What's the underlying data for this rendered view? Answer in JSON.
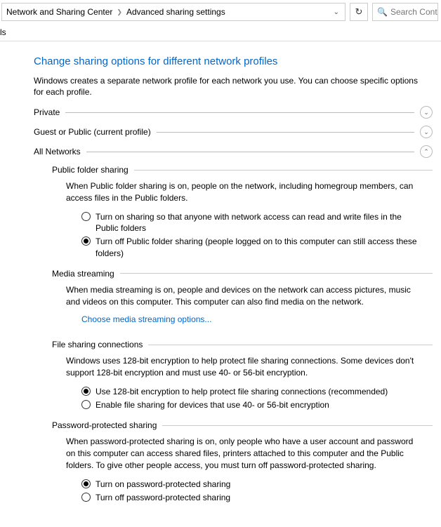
{
  "breadcrumb": {
    "parent": "Network and Sharing Center",
    "current": "Advanced sharing settings"
  },
  "search": {
    "placeholder": "Search Cont"
  },
  "toolbar": {
    "partial": "ls"
  },
  "page": {
    "title": "Change sharing options for different network profiles",
    "description": "Windows creates a separate network profile for each network you use. You can choose specific options for each profile."
  },
  "sections": {
    "private": {
      "label": "Private"
    },
    "guest": {
      "label": "Guest or Public (current profile)"
    },
    "all": {
      "label": "All Networks"
    }
  },
  "publicFolder": {
    "heading": "Public folder sharing",
    "desc": "When Public folder sharing is on, people on the network, including homegroup members, can access files in the Public folders.",
    "opt1": "Turn on sharing so that anyone with network access can read and write files in the Public folders",
    "opt2": "Turn off Public folder sharing (people logged on to this computer can still access these folders)"
  },
  "media": {
    "heading": "Media streaming",
    "desc": "When media streaming is on, people and devices on the network can access pictures, music and videos on this computer. This computer can also find media on the network.",
    "link": "Choose media streaming options..."
  },
  "fileSharing": {
    "heading": "File sharing connections",
    "desc": "Windows uses 128-bit encryption to help protect file sharing connections. Some devices don't support 128-bit encryption and must use 40- or 56-bit encryption.",
    "opt1": "Use 128-bit encryption to help protect file sharing connections (recommended)",
    "opt2": "Enable file sharing for devices that use 40- or 56-bit encryption"
  },
  "password": {
    "heading": "Password-protected sharing",
    "desc": "When password-protected sharing is on, only people who have a user account and password on this computer can access shared files, printers attached to this computer and the Public folders. To give other people access, you must turn off password-protected sharing.",
    "opt1": "Turn on password-protected sharing",
    "opt2": "Turn off password-protected sharing"
  }
}
